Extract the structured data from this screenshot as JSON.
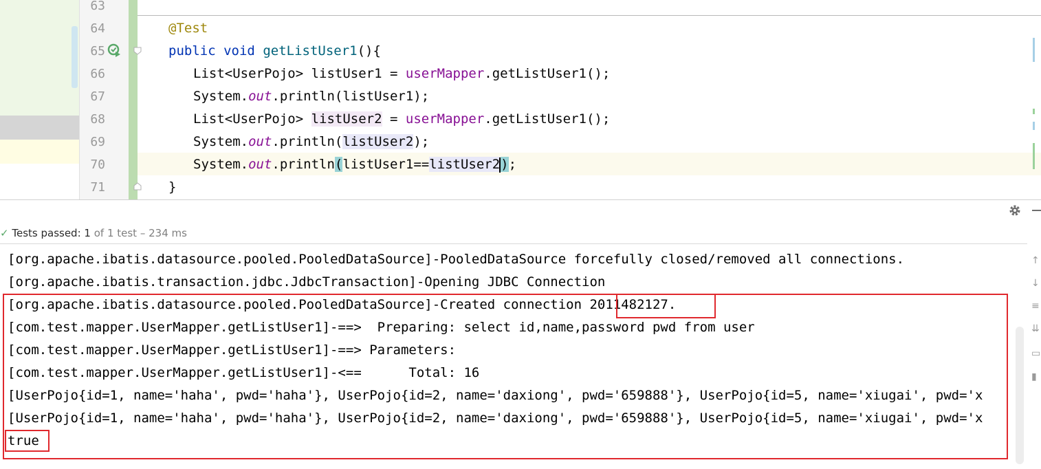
{
  "editor": {
    "lines": [
      {
        "num": "63"
      },
      {
        "num": "64",
        "annotation": "@Test"
      },
      {
        "num": "65",
        "kw1": "public",
        "kw2": "void",
        "method": "getListUser1",
        "rest": "(){"
      },
      {
        "num": "66",
        "type": "List<UserPojo>",
        "var": "listUser1",
        "eq": " = ",
        "field": "userMapper",
        "call": ".getListUser1();"
      },
      {
        "num": "67",
        "sys": "System.",
        "out": "out",
        "print": ".println(listUser1);"
      },
      {
        "num": "68",
        "type": "List<UserPojo>",
        "var": "listUser2",
        "eq": " = ",
        "field": "userMapper",
        "call": ".getListUser1();"
      },
      {
        "num": "69",
        "sys": "System.",
        "out": "out",
        "print": ".println(",
        "arg": "listUser2",
        "close": ");"
      },
      {
        "num": "70",
        "sys": "System.",
        "out": "out",
        "print": ".println",
        "paren_open": "(",
        "arg1": "listUser1==",
        "arg2": "listUser2",
        "paren_close": ")",
        "semi": ";"
      },
      {
        "num": "71",
        "brace": "}"
      }
    ]
  },
  "test_status": {
    "check": "✓",
    "label": "Tests passed: ",
    "count": "1",
    "of": " of 1 test – 234 ms"
  },
  "console": {
    "lines": [
      "[org.apache.ibatis.datasource.pooled.PooledDataSource]-PooledDataSource forcefully closed/removed all connections.",
      "[org.apache.ibatis.transaction.jdbc.JdbcTransaction]-Opening JDBC Connection",
      "[org.apache.ibatis.datasource.pooled.PooledDataSource]-Created connection 2011482127.",
      "[com.test.mapper.UserMapper.getListUser1]-==>  Preparing: select id,name,password pwd from user",
      "[com.test.mapper.UserMapper.getListUser1]-==> Parameters: ",
      "[com.test.mapper.UserMapper.getListUser1]-<==      Total: 16",
      "[UserPojo{id=1, name='haha', pwd='haha'}, UserPojo{id=2, name='daxiong', pwd='659888'}, UserPojo{id=5, name='xiugai', pwd='x",
      "[UserPojo{id=1, name='haha', pwd='haha'}, UserPojo{id=2, name='daxiong', pwd='659888'}, UserPojo{id=5, name='xiugai', pwd='x",
      "true"
    ]
  },
  "icons": {
    "run": "run-test-icon",
    "gear": "gear-icon",
    "minimize": "minimize-icon",
    "scroll_up": "arrow-up-icon",
    "scroll_down": "arrow-down-icon",
    "soft_wrap": "soft-wrap-icon",
    "scroll_end": "scroll-to-end-icon",
    "print": "print-icon",
    "clear": "trash-icon"
  },
  "colors": {
    "highlight_box": "#e0282d",
    "passed": "#59a869"
  }
}
